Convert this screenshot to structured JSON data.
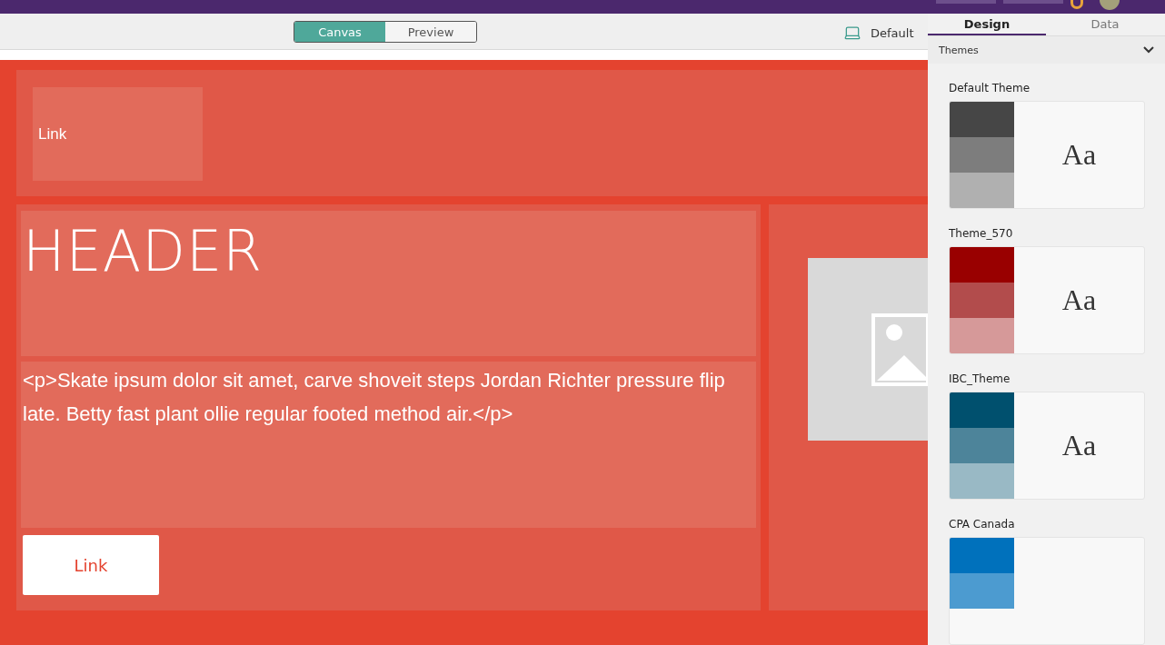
{
  "toolbar": {
    "view_toggle": [
      {
        "label": "Canvas",
        "selected": true
      },
      {
        "label": "Preview",
        "selected": false
      }
    ],
    "device": "Default"
  },
  "canvas": {
    "nav_link": "Link",
    "header": "HEADER",
    "paragraph": "<p>Skate ipsum dolor sit amet, carve shoveit steps Jordan Richter pressure flip late. Betty fast plant ollie regular footed method air.</p>",
    "button": "Link",
    "image": {
      "kind": "placeholder"
    }
  },
  "panel": {
    "tabs": [
      {
        "label": "Design",
        "selected": true
      },
      {
        "label": "Data",
        "selected": false
      }
    ],
    "section": {
      "title": "Themes",
      "expanded": true
    },
    "themes": [
      {
        "name": "Default Theme",
        "swatches": [
          {
            "color": "#464646"
          },
          {
            "color": "#7d7d7d"
          },
          {
            "color": "#b0b0b0"
          }
        ],
        "sample": "Aa"
      },
      {
        "name": "Theme_570",
        "swatches": [
          {
            "color": "#990000"
          },
          {
            "color": "#b24c4c"
          },
          {
            "color": "#d69999"
          }
        ],
        "sample": "Aa"
      },
      {
        "name": "IBC_Theme",
        "swatches": [
          {
            "color": "#00506e"
          },
          {
            "color": "#4d849a"
          },
          {
            "color": "#99b9c5"
          }
        ],
        "sample": "Aa"
      },
      {
        "name": "CPA Canada",
        "swatches": [
          {
            "color": "#0071bc"
          },
          {
            "color": "#4c9bd0"
          }
        ]
      }
    ]
  }
}
